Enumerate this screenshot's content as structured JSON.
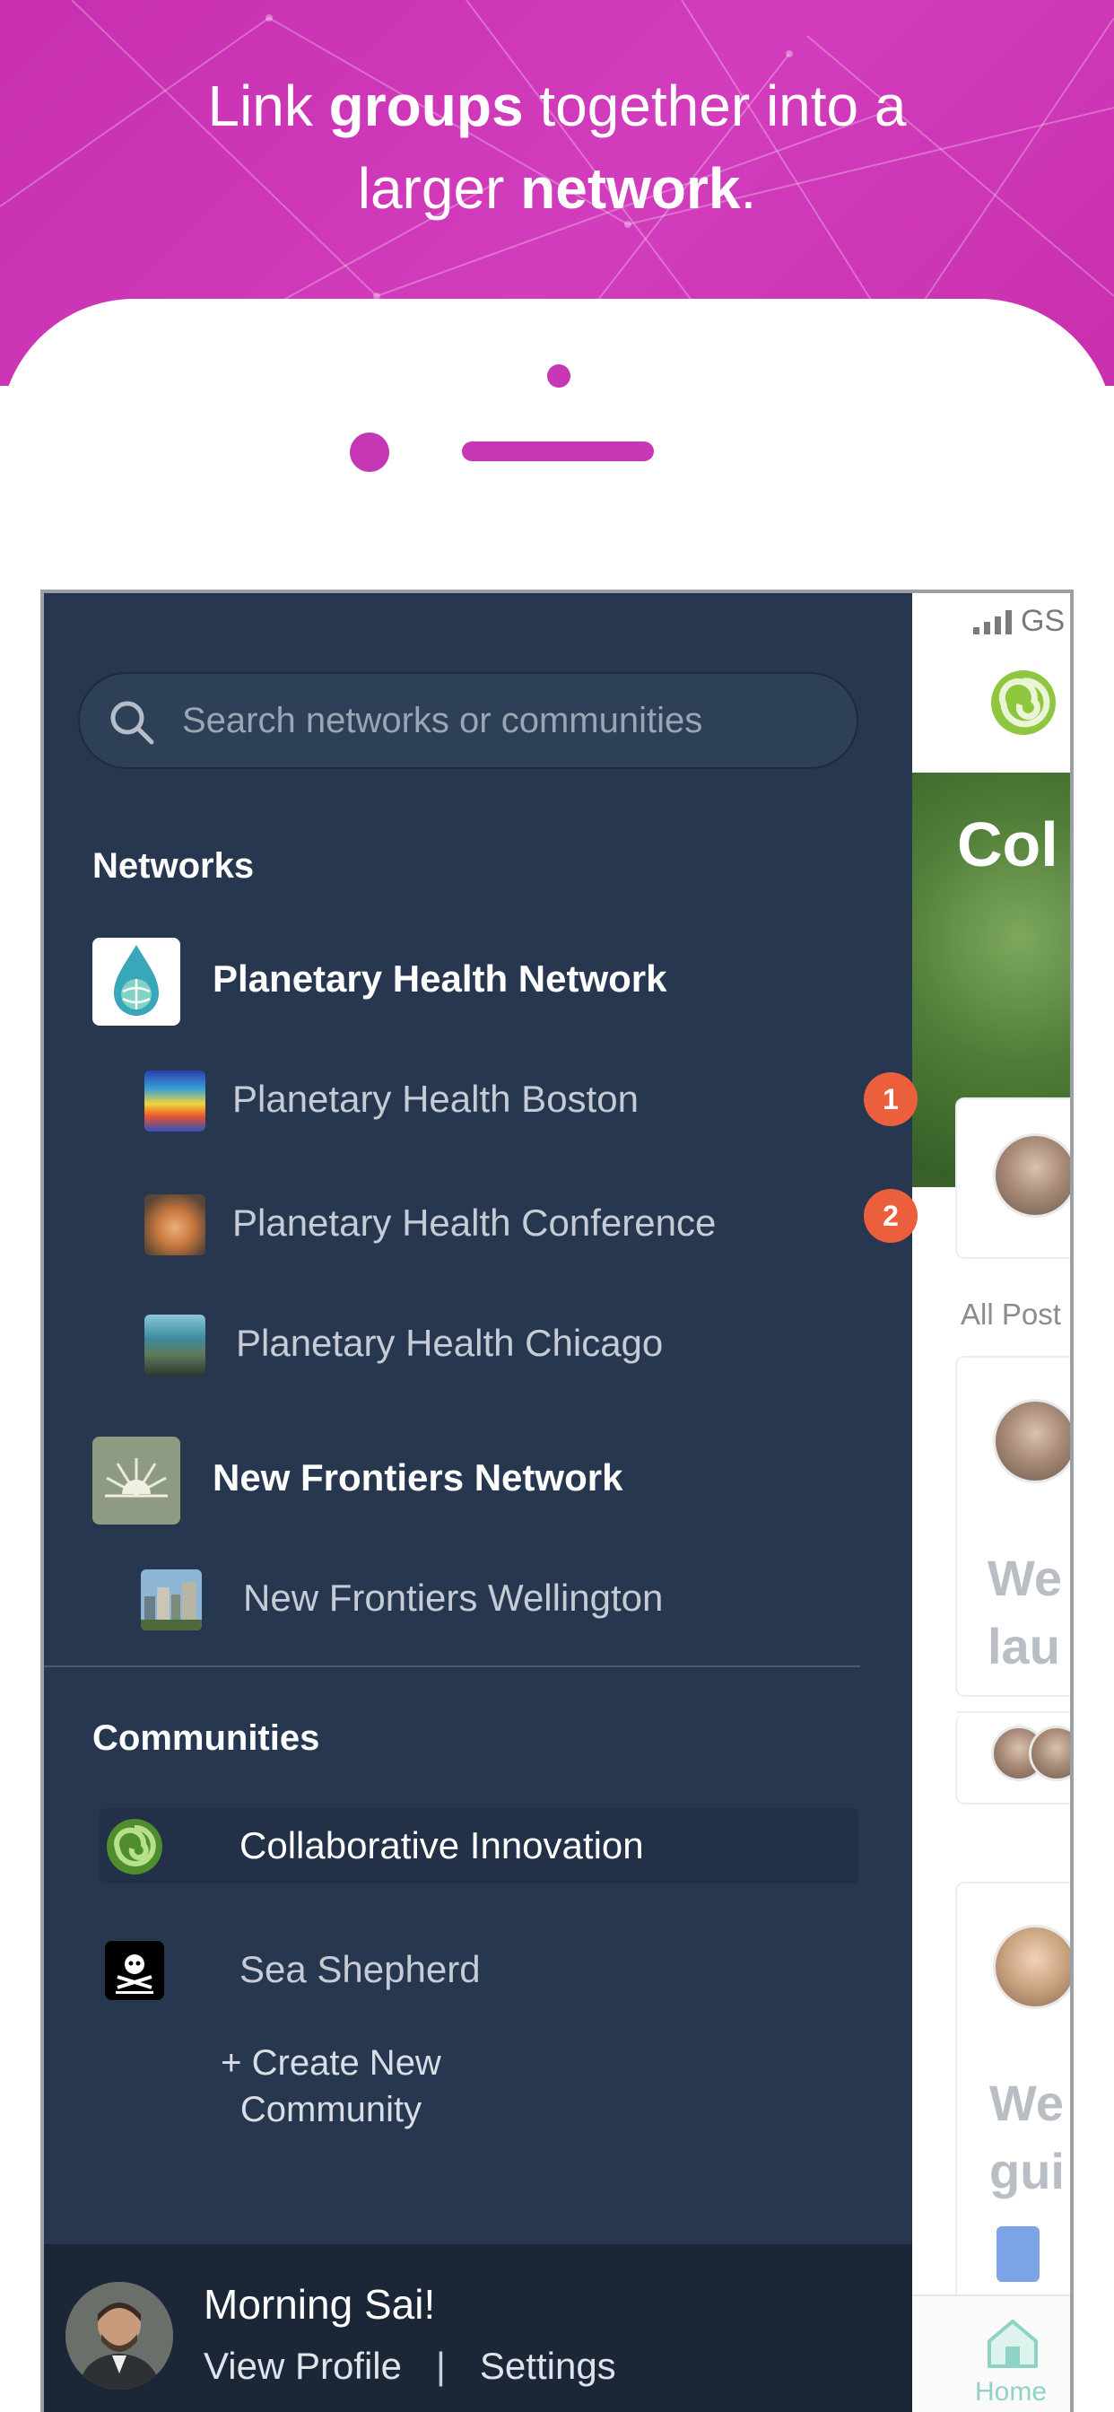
{
  "hero": {
    "line1_pre": "Link ",
    "line1_bold": "groups",
    "line1_post": " together into a",
    "line2_pre": "larger ",
    "line2_bold": "network",
    "line2_post": "."
  },
  "status_bar": {
    "carrier": "GS",
    "signal_icon": "signal-bars-icon",
    "wifi_icon": "wifi-icon"
  },
  "drawer": {
    "search": {
      "placeholder": "Search networks or communities",
      "icon": "search-icon"
    },
    "networks_title": "Networks",
    "networks": [
      {
        "name": "Planetary Health Network",
        "icon": "planetary-health-logo",
        "communities": [
          {
            "name": "Planetary Health Boston",
            "badge": "1",
            "thumb": "heatmap-thumb"
          },
          {
            "name": "Planetary Health Conference",
            "badge": "2",
            "thumb": "fox-thumb"
          },
          {
            "name": "Planetary Health Chicago",
            "badge": "",
            "thumb": "reef-thumb"
          }
        ]
      },
      {
        "name": "New Frontiers Network",
        "icon": "sunrise-logo",
        "communities": [
          {
            "name": "New Frontiers Wellington",
            "badge": "",
            "thumb": "city-thumb"
          }
        ]
      }
    ],
    "communities_title": "Communities",
    "communities": [
      {
        "name": "Collaborative Innovation",
        "active": true,
        "icon": "green-spiral-logo"
      },
      {
        "name": "Sea Shepherd",
        "active": false,
        "icon": "jolly-roger-logo"
      }
    ],
    "create_line1": "+ Create New",
    "create_line2": "Community",
    "footer": {
      "greeting": "Morning Sai!",
      "view_profile": "View Profile",
      "separator": "|",
      "settings": "Settings"
    }
  },
  "app_peek": {
    "banner_text": "Col",
    "all_posts": "All Post",
    "post1_line1": "We",
    "post1_line2": "lau",
    "post2_line1": "We",
    "post2_line2": "gui",
    "tab_home": "Home"
  },
  "colors": {
    "hero": "#c72fb0",
    "drawer": "#27374f",
    "footer": "#1b2637",
    "badge": "#ec5f3c",
    "accent_teal": "#8ed3c4"
  }
}
